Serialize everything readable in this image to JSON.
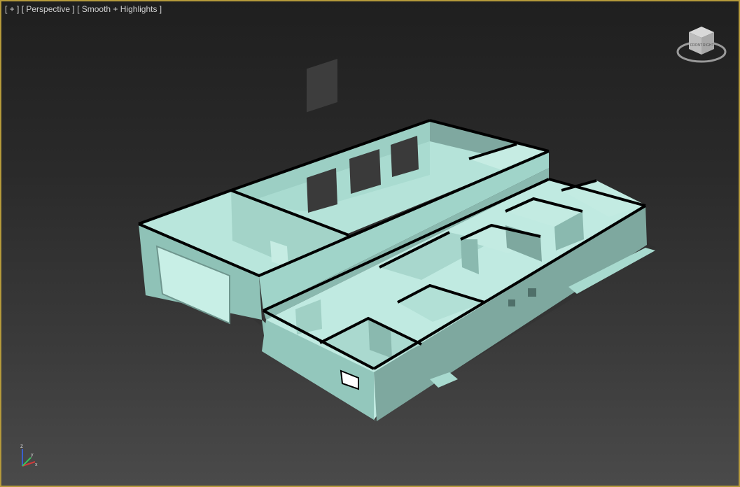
{
  "viewport": {
    "label_plus": "[ + ]",
    "label_view": "[ Perspective ]",
    "label_shading": "[ Smooth + Highlights ]"
  },
  "viewcube": {
    "front": "FRONT",
    "right": "RIGHT"
  },
  "axis": {
    "z": "z",
    "x": "x",
    "y": "y"
  },
  "colors": {
    "border": "#b59a3b",
    "wall_top": "#a9ddd2",
    "wall_side": "#8cc0b5",
    "wall_dark": "#6f968e",
    "floor": "#b9e6dc",
    "outline": "#000000"
  }
}
